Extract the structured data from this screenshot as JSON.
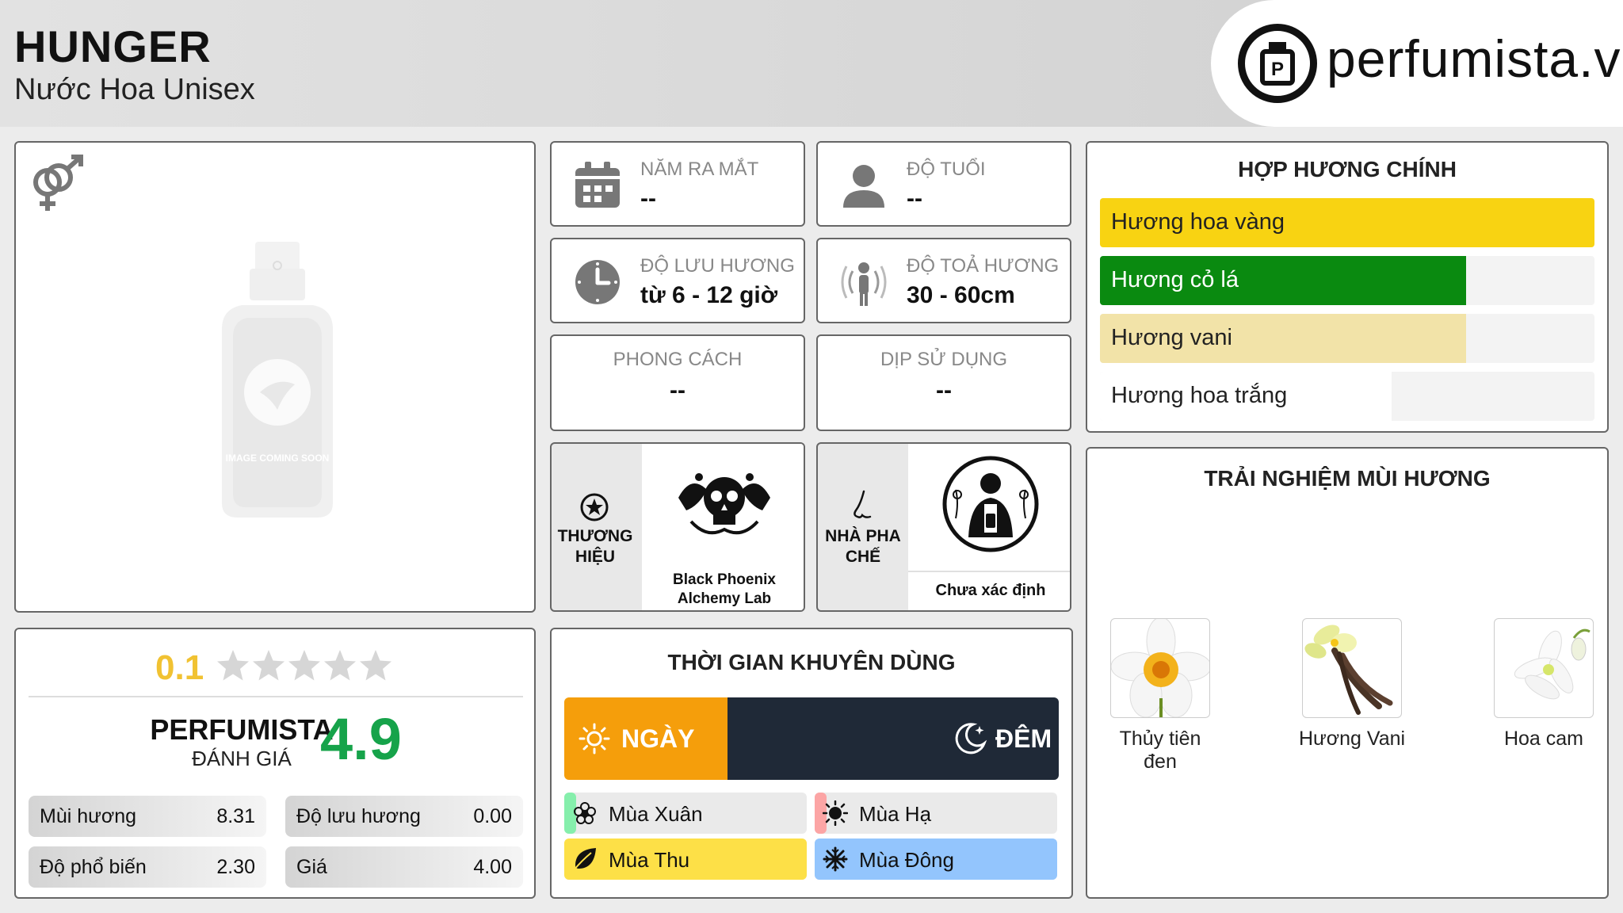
{
  "header": {
    "title": "HUNGER",
    "subtitle": "Nước Hoa Unisex",
    "logo_text": "perfumista.vn"
  },
  "image_panel": {
    "placeholder_text": "IMAGE COMING SOON",
    "gender_icon": "gender-unisex-icon"
  },
  "info_cards": {
    "release_year": {
      "label": "NĂM RA MẮT",
      "value": "--",
      "icon": "calendar-icon"
    },
    "age": {
      "label": "ĐỘ TUỔI",
      "value": "--",
      "icon": "person-icon"
    },
    "longevity": {
      "label": "ĐỘ LƯU HƯƠNG",
      "value": "từ 6 - 12 giờ",
      "icon": "clock-icon"
    },
    "sillage": {
      "label": "ĐỘ TOẢ HƯƠNG",
      "value": "30 - 60cm",
      "icon": "sillage-icon"
    },
    "style": {
      "label": "PHONG CÁCH",
      "value": "--"
    },
    "occasion": {
      "label": "DỊP SỬ DỤNG",
      "value": "--"
    },
    "brand": {
      "label_line1": "THƯƠNG",
      "label_line2": "HIỆU",
      "name": "Black Phoenix Alchemy Lab",
      "icon": "star-badge-icon"
    },
    "perfumer": {
      "label_line1": "NHÀ PHA",
      "label_line2": "CHẾ",
      "name": "Chưa xác định",
      "icon": "nose-icon"
    }
  },
  "accords": {
    "title": "HỢP HƯƠNG CHÍNH",
    "items": [
      {
        "label": "Hương hoa vàng",
        "value": 100,
        "color": "#f8d312",
        "text_color": "#222"
      },
      {
        "label": "Hương cỏ lá",
        "value": 74,
        "color": "#0a8a10",
        "text_color": "#ffffff"
      },
      {
        "label": "Hương vani",
        "value": 74,
        "color": "#f2e3a8",
        "text_color": "#222"
      },
      {
        "label": "Hương hoa trắng",
        "value": 59,
        "color": "#ffffff",
        "text_color": "#222"
      }
    ]
  },
  "rating": {
    "user_score": "0.1",
    "stars_filled": 0.02,
    "stars_total": 5,
    "brand_line1": "PERFUMISTA",
    "brand_line2": "ĐÁNH GIÁ",
    "brand_score": "4.9",
    "metrics": [
      {
        "label": "Mùi hương",
        "value": "8.31"
      },
      {
        "label": "Độ lưu hương",
        "value": "0.00"
      },
      {
        "label": "Độ phổ biến",
        "value": "2.30"
      },
      {
        "label": "Giá",
        "value": "4.00"
      }
    ]
  },
  "usage_time": {
    "title": "THỜI GIAN KHUYÊN DÙNG",
    "day_label": "NGÀY",
    "night_label": "ĐÊM",
    "day_fraction": 0.33,
    "day_color": "#f59e0b",
    "night_color": "#1f2937",
    "seasons": [
      {
        "label": "Mùa Xuân",
        "fill": 0.05,
        "color": "#86efac",
        "icon": "flower-icon"
      },
      {
        "label": "Mùa Hạ",
        "fill": 0.05,
        "color": "#fca5a5",
        "icon": "sun-icon"
      },
      {
        "label": "Mùa Thu",
        "fill": 1.0,
        "color": "#fde047",
        "icon": "leaf-icon"
      },
      {
        "label": "Mùa Đông",
        "fill": 1.0,
        "color": "#93c5fd",
        "icon": "snowflake-icon"
      }
    ]
  },
  "experience": {
    "title": "TRẢI NGHIỆM MÙI HƯƠNG",
    "notes": [
      {
        "name_line1": "Thủy tiên",
        "name_line2": "đen",
        "icon": "narcissus-icon"
      },
      {
        "name_line1": "Hương Vani",
        "name_line2": "",
        "icon": "vanilla-icon"
      },
      {
        "name_line1": "Hoa cam",
        "name_line2": "",
        "icon": "orange-blossom-icon"
      }
    ]
  }
}
